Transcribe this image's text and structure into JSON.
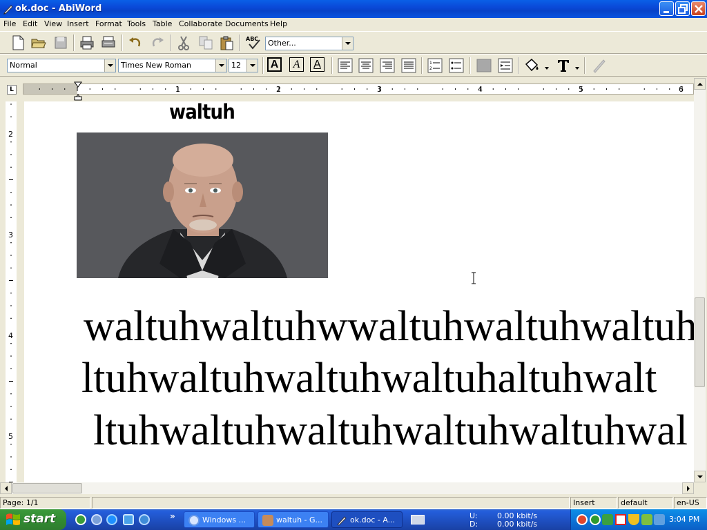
{
  "window": {
    "title": "ok.doc - AbiWord"
  },
  "menu": [
    "File",
    "Edit",
    "View",
    "Insert",
    "Format",
    "Tools",
    "Table",
    "Collaborate",
    "Documents",
    "Help"
  ],
  "toolbar": {
    "zoom_value": "Other...",
    "style_value": "Normal",
    "font_value": "Times New Roman",
    "size_value": "12",
    "bold_label": "A",
    "italic_label": "A",
    "underline_label": "A",
    "spell_label": "ABC"
  },
  "ruler": {
    "tab_label": "L",
    "h_numbers": [
      "1",
      "2",
      "3",
      "4",
      "5",
      "6"
    ],
    "v_numbers": [
      "2",
      "3",
      "4",
      "5"
    ]
  },
  "document": {
    "heading": "waltuh",
    "lines": [
      "waltuhwaltuhwwaltuhwaltuhwaltuh",
      "ltuhwaltuhwaltuhwaltuhaltuhwalt",
      "ltuhwaltuhwaltuhwaltuhwaltuhwal"
    ]
  },
  "status": {
    "page": "Page: 1/1",
    "mode": "Insert",
    "style": "default",
    "lang": "en-US"
  },
  "taskbar": {
    "start_label": "start",
    "overflow_label": "»",
    "tasks": [
      "Windows ...",
      "waltuh - G...",
      "ok.doc - A..."
    ],
    "net_up_label": "U:",
    "net_down_label": "D:",
    "net_up": "0.00 kbit/s",
    "net_down": "0.00 kbit/s",
    "clock": "3:04 PM"
  },
  "colors": {
    "titlebar": "#0a49d8",
    "taskbar": "#245edb",
    "start": "#318b31",
    "tray": "#0d76d8"
  }
}
